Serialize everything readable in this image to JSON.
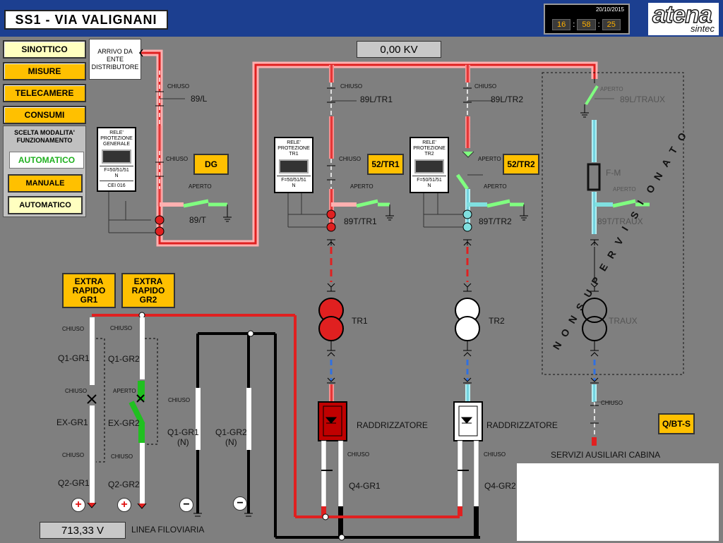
{
  "header": {
    "title": "SS1 - VIA VALIGNANI",
    "date": "20/10/2015",
    "clock_h": "16",
    "clock_m": "58",
    "clock_s": "25",
    "clock_sep": ":",
    "logo_main": "atena",
    "logo_sub": "sintec"
  },
  "menu": {
    "sinottico": "SINOTTICO",
    "misure": "MISURE",
    "telecamere": "TELECAMERE",
    "consumi": "CONSUMI"
  },
  "arrivo": "ARRIVO DA\nENTE\nDISTRIBUTORE",
  "mode": {
    "title": "SCELTA MODALITA'\nFUNZIONAMENTO",
    "current": "AUTOMATICO",
    "manuale": "MANUALE",
    "automatico": "AUTOMATICO"
  },
  "kv_reading": "0,00 KV",
  "voltage_reading": "713,33 V",
  "relays": {
    "generale": {
      "title": "RELE'\nPROTEZIONE\nGENERALE",
      "funcs": "F=50/51/51\nN",
      "code": "CEI 016"
    },
    "tr1": {
      "title": "RELE'\nPROTEZIONE\nTR1",
      "funcs": "F=50/51/51\nN"
    },
    "tr2": {
      "title": "RELE'\nPROTEZIONE\nTR2",
      "funcs": "F=50/51/51\nN"
    }
  },
  "buttons": {
    "dg": "DG",
    "tr1": "52/TR1",
    "tr2": "52/TR2",
    "qbt": "Q/BT-S",
    "gr1": "EXTRA\nRAPIDO\nGR1",
    "gr2": "EXTRA\nRAPIDO\nGR2"
  },
  "labels": {
    "chiuso": "CHIUSO",
    "aperto": "APERTO",
    "s89l": "89/L",
    "s89t": "89/T",
    "s89ltr1": "89L/TR1",
    "s89ttr1": "89T/TR1",
    "s89ltr2": "89L/TR2",
    "s89ttr2": "89T/TR2",
    "s89ltraux": "89L/TRAUX",
    "s89ttraux": "89T/TRAUX",
    "fm": "F-M",
    "tr1": "TR1",
    "tr2": "TR2",
    "traux": "TRAUX",
    "raddrizzatore": "RADDRIZZATORE",
    "q1gr1": "Q1-GR1",
    "q1gr2": "Q1-GR2",
    "exgr1": "EX-GR1",
    "exgr2": "EX-GR2",
    "q2gr1": "Q2-GR1",
    "q2gr2": "Q2-GR2",
    "q1gr1n": "Q1-GR1\n(N)",
    "q1gr2n": "Q1-GR2\n(N)",
    "q4gr1": "Q4-GR1",
    "q4gr2": "Q4-GR2",
    "linea": "LINEA FILOVIARIA",
    "servizi": "SERVIZI AUSILIARI CABINA",
    "plus": "+",
    "minus": "−"
  },
  "non_supervisionato": [
    "N",
    "O",
    "N",
    "S",
    "U",
    "P",
    "E",
    "R",
    "V",
    "I",
    "S",
    "I",
    "O",
    "N",
    "A",
    "T",
    "O"
  ],
  "colors": {
    "live": "#e02020",
    "live_glow": "#ffb0b0",
    "dead": "#ffffff",
    "aux": "#80e0e0",
    "closed_green": "#20c020",
    "title_blue": "#1c3f90",
    "accent": "#ffc000"
  }
}
